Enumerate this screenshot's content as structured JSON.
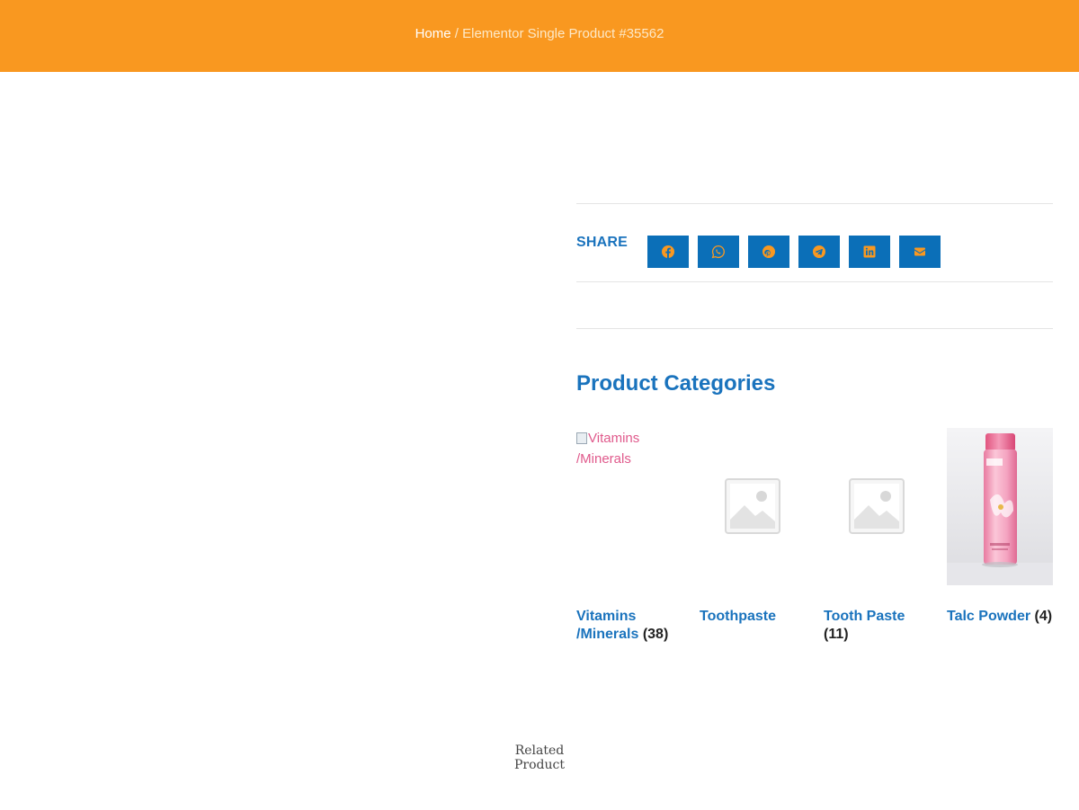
{
  "header": {
    "breadcrumb": {
      "home": "Home",
      "separator": " / ",
      "current": "Elementor Single Product #35562"
    },
    "background_color": "#f99820"
  },
  "share": {
    "label": "SHARE",
    "button_color": "#0b6fb8",
    "buttons": [
      {
        "network": "facebook",
        "icon": "facebook-icon"
      },
      {
        "network": "whatsapp",
        "icon": "whatsapp-icon"
      },
      {
        "network": "pinterest",
        "icon": "pinterest-icon"
      },
      {
        "network": "telegram",
        "icon": "telegram-icon"
      },
      {
        "network": "linkedin",
        "icon": "linkedin-icon"
      },
      {
        "network": "email",
        "icon": "envelope-icon"
      }
    ]
  },
  "product_categories": {
    "title": "Product Categories",
    "accent_color": "#1a73bd",
    "items": [
      {
        "name": "Vitamins /Minerals",
        "name_line1": "Vitamins",
        "name_line2": "/Minerals",
        "count": "(38)",
        "image_alt": "Vitamins /Minerals",
        "image": "broken-image"
      },
      {
        "name": "Toothpaste",
        "count": "",
        "image": "placeholder-image-icon"
      },
      {
        "name": "Tooth Paste",
        "count": "(11)",
        "image": "placeholder-image-icon"
      },
      {
        "name": "Talc Powder",
        "count": "(4)",
        "image": "talc-powder-photo"
      }
    ]
  },
  "related": {
    "line1": "Related",
    "line2": "Product"
  }
}
